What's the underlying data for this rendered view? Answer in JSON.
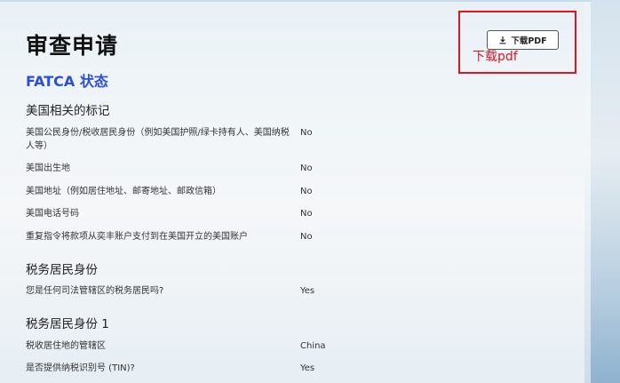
{
  "header": {
    "title": "审查申请",
    "download_label": "下载PDF"
  },
  "annotation": {
    "text": "下载pdf",
    "color": "#e0161e"
  },
  "fatca": {
    "title": "FATCA 状态",
    "us_indicators": {
      "heading": "美国相关的标记",
      "rows": [
        {
          "label": "美国公民身份/税收居民身份（例如美国护照/绿卡持有人、美国纳税人等）",
          "value": "No"
        },
        {
          "label": "美国出生地",
          "value": "No"
        },
        {
          "label": "美国地址（例如居住地址、邮寄地址、邮政信箱）",
          "value": "No"
        },
        {
          "label": "美国电话号码",
          "value": "No"
        },
        {
          "label": "重复指令将款项从奕丰账户支付到在美国开立的美国账户",
          "value": "No"
        }
      ]
    },
    "tax_residency": {
      "heading": "税务居民身份",
      "rows": [
        {
          "label": "您是任何司法管辖区的税务居民吗?",
          "value": "Yes"
        }
      ]
    },
    "tax_residency_1": {
      "heading": "税务居民身份 1",
      "rows": [
        {
          "label": "税收居住地的管辖区",
          "value": "China"
        },
        {
          "label": "是否提供纳税识别号 (TIN)?",
          "value": "Yes"
        }
      ]
    }
  },
  "colors": {
    "accent": "#2b4fd6",
    "annotation": "#e0161e"
  }
}
